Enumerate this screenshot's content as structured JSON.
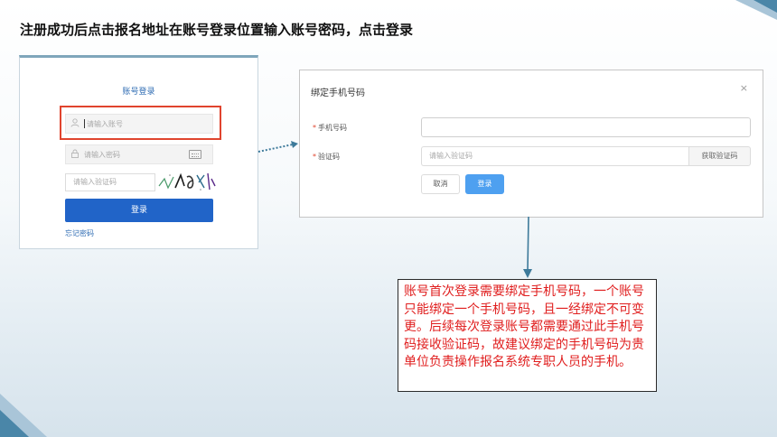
{
  "slide": {
    "title": "注册成功后点击报名地址在账号登录位置输入账号密码，点击登录"
  },
  "login": {
    "title": "账号登录",
    "username_placeholder": "请输入账号",
    "password_placeholder": "请输入密码",
    "code_placeholder": "请输入验证码",
    "login_button": "登录",
    "forgot_link": "忘记密码",
    "icons": [
      "user-icon",
      "lock-icon",
      "keyboard-icon"
    ]
  },
  "dialog": {
    "title": "绑定手机号码",
    "close": "×",
    "phone_label": "手机号码",
    "code_label": "验证码",
    "required_mark": "*",
    "code_placeholder": "请输入验证码",
    "get_code_button": "获取验证码",
    "cancel_button": "取消",
    "confirm_button": "登录"
  },
  "note": {
    "text": "账号首次登录需要绑定手机号码，一个账号只能绑定一个手机号码，且一经绑定不可变更。后续每次登录账号都需要通过此手机号码接收验证码，故建议绑定的手机号码为贵单位负责操作报名系统专职人员的手机。"
  },
  "colors": {
    "primary_button": "#2164c8",
    "dialog_confirm": "#4ea0f0",
    "highlight_frame": "#e0442e",
    "note_text": "#e01e1e",
    "accent_teal": "#4a86a8"
  }
}
